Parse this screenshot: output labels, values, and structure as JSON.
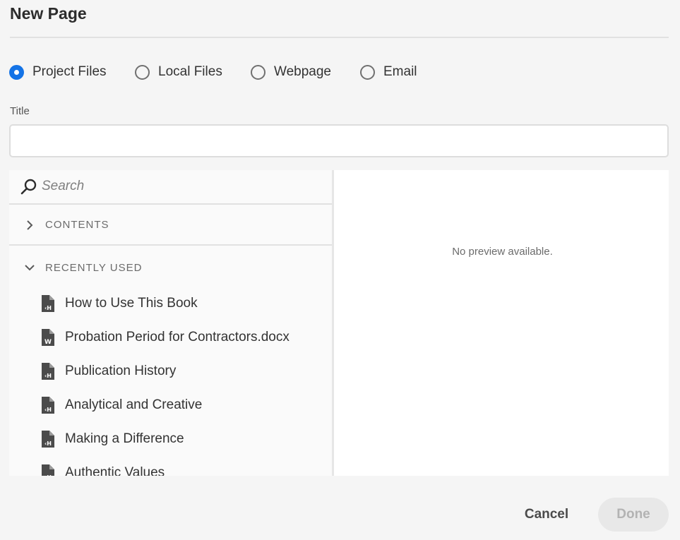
{
  "dialog": {
    "title": "New Page"
  },
  "source_options": [
    {
      "label": "Project Files",
      "checked": true
    },
    {
      "label": "Local Files",
      "checked": false
    },
    {
      "label": "Webpage",
      "checked": false
    },
    {
      "label": "Email",
      "checked": false
    }
  ],
  "title_field": {
    "label": "Title",
    "value": "",
    "placeholder": ""
  },
  "browser": {
    "search_placeholder": "Search",
    "sections": {
      "contents": {
        "label": "CONTENTS",
        "expanded": false
      },
      "recently_used": {
        "label": "RECENTLY USED",
        "expanded": true
      }
    },
    "recent_items": [
      {
        "name": "How to Use This Book",
        "icon": "html-file-icon"
      },
      {
        "name": "Probation Period for Contractors.docx",
        "icon": "word-file-icon"
      },
      {
        "name": "Publication History",
        "icon": "html-file-icon"
      },
      {
        "name": "Analytical and Creative",
        "icon": "html-file-icon"
      },
      {
        "name": "Making a Difference",
        "icon": "html-file-icon"
      },
      {
        "name": "Authentic Values",
        "icon": "html-file-icon"
      }
    ]
  },
  "preview": {
    "empty_text": "No preview available."
  },
  "actions": {
    "cancel_label": "Cancel",
    "done_label": "Done",
    "done_enabled": false
  },
  "colors": {
    "accent": "#1473e6",
    "background": "#f5f5f5",
    "text": "#2c2c2c"
  }
}
